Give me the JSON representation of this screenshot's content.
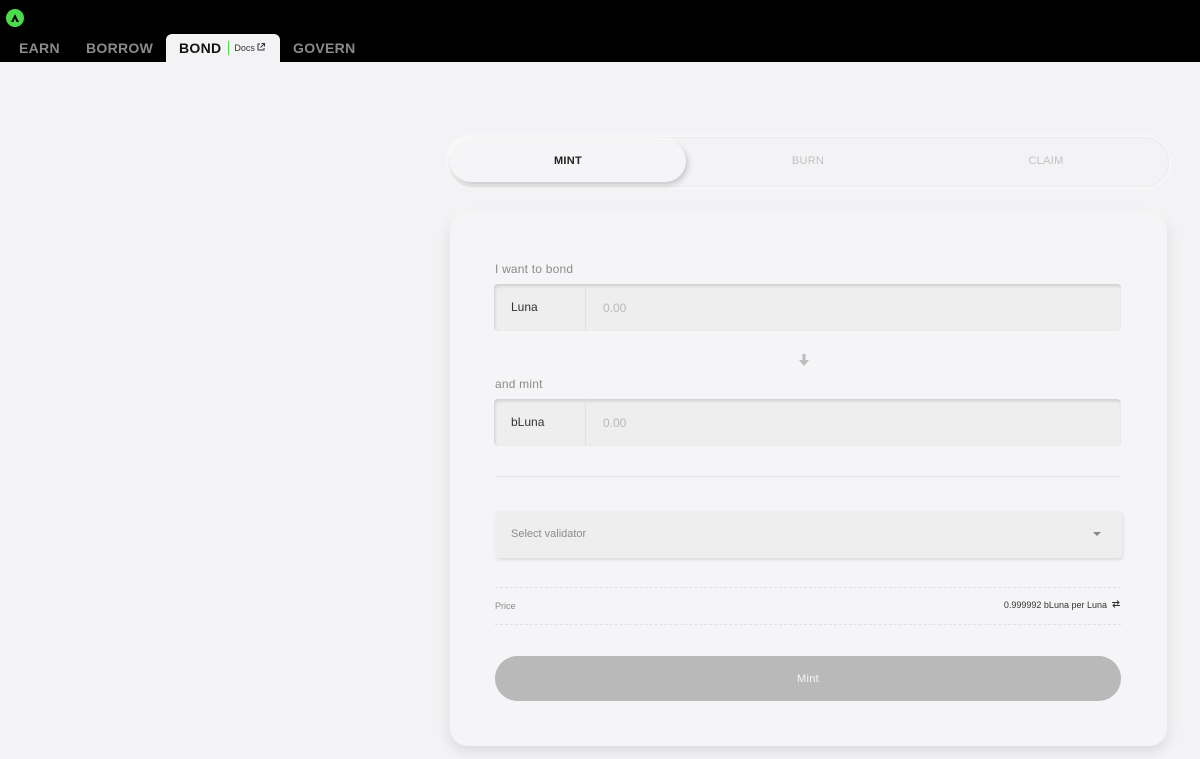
{
  "header": {
    "logo_icon": "anchor-logo-icon",
    "accent_color": "#4bdb4b",
    "nav": {
      "earn": "EARN",
      "borrow": "BORROW",
      "bond": "BOND",
      "docs": "Docs",
      "govern": "GOVERN"
    },
    "active_tab": "BOND"
  },
  "tabs": {
    "mint": "MINT",
    "burn": "BURN",
    "claim": "CLAIM",
    "active": "MINT"
  },
  "form": {
    "bond_label": "I want to bond",
    "bond_token": "Luna",
    "bond_placeholder": "0.00",
    "mint_label": "and mint",
    "mint_token": "bLuna",
    "mint_placeholder": "0.00",
    "validator_placeholder": "Select validator",
    "price_label": "Price",
    "price_value": "0.999992 bLuna per Luna",
    "submit_label": "Mint"
  }
}
